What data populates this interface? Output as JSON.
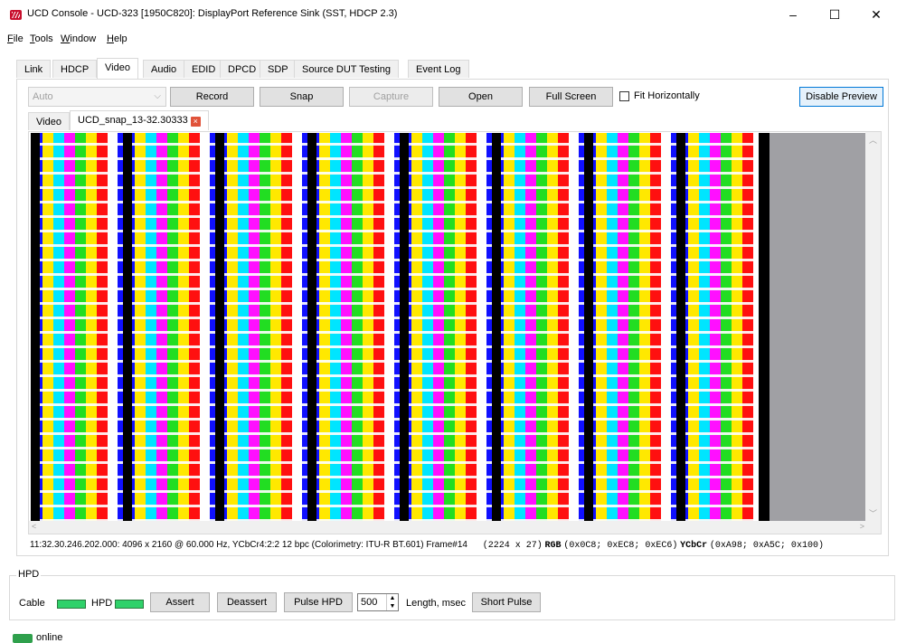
{
  "window": {
    "title": "UCD Console - UCD-323 [1950C820]: DisplayPort Reference Sink (SST, HDCP 2.3)",
    "minimize": "–",
    "maximize": "☐",
    "close": "✕"
  },
  "menu": [
    {
      "label": "File",
      "key": "F"
    },
    {
      "label": "Tools",
      "key": "T"
    },
    {
      "label": "Window",
      "key": "W"
    },
    {
      "label": "Help",
      "key": "H"
    }
  ],
  "tabs": [
    "Link",
    "HDCP",
    "Video",
    "Audio",
    "EDID",
    "DPCD",
    "SDP",
    "Source DUT Testing",
    "Event Log"
  ],
  "active_tab": "Video",
  "toolbar": {
    "mode_select": "Auto",
    "record": "Record",
    "snap": "Snap",
    "capture": "Capture",
    "open": "Open",
    "full_screen": "Full Screen",
    "fit_horizontally": "Fit Horizontally",
    "fit_horizontally_checked": false,
    "disable_preview": "Disable Preview"
  },
  "subtabs": {
    "video": "Video",
    "snap": "UCD_snap_13-32.30333"
  },
  "status_line": {
    "info": "11:32.30.246.202.000: 4096 x 2160 @ 60.000 Hz, YCbCr4:2:2 12 bpc (Colorimetry: ITU-R BT.601) Frame#14",
    "pixel": "(2224 x 27)",
    "rgb_label": "RGB",
    "rgb_value": "(0x0C8; 0xEC8; 0xEC6)",
    "ycbcr_label": "YCbCr",
    "ycbcr_value": "(0xA98; 0xA5C; 0x100)"
  },
  "hpd": {
    "group_title": "HPD",
    "cable": "Cable",
    "hpd": "HPD",
    "assert": "Assert",
    "deassert": "Deassert",
    "pulse_hpd": "Pulse HPD",
    "length_value": "500",
    "length_label": "Length, msec",
    "short_pulse": "Short Pulse"
  },
  "connection": {
    "status": "online"
  },
  "colors": {
    "blue": "#1010ff",
    "yellow": "#ffe800",
    "cyan": "#00e5ff",
    "magenta": "#ff10ff",
    "green": "#22dd22",
    "red": "#ff1010",
    "white": "#ffffff",
    "black": "#000000",
    "led_green": "#2fd16a"
  }
}
